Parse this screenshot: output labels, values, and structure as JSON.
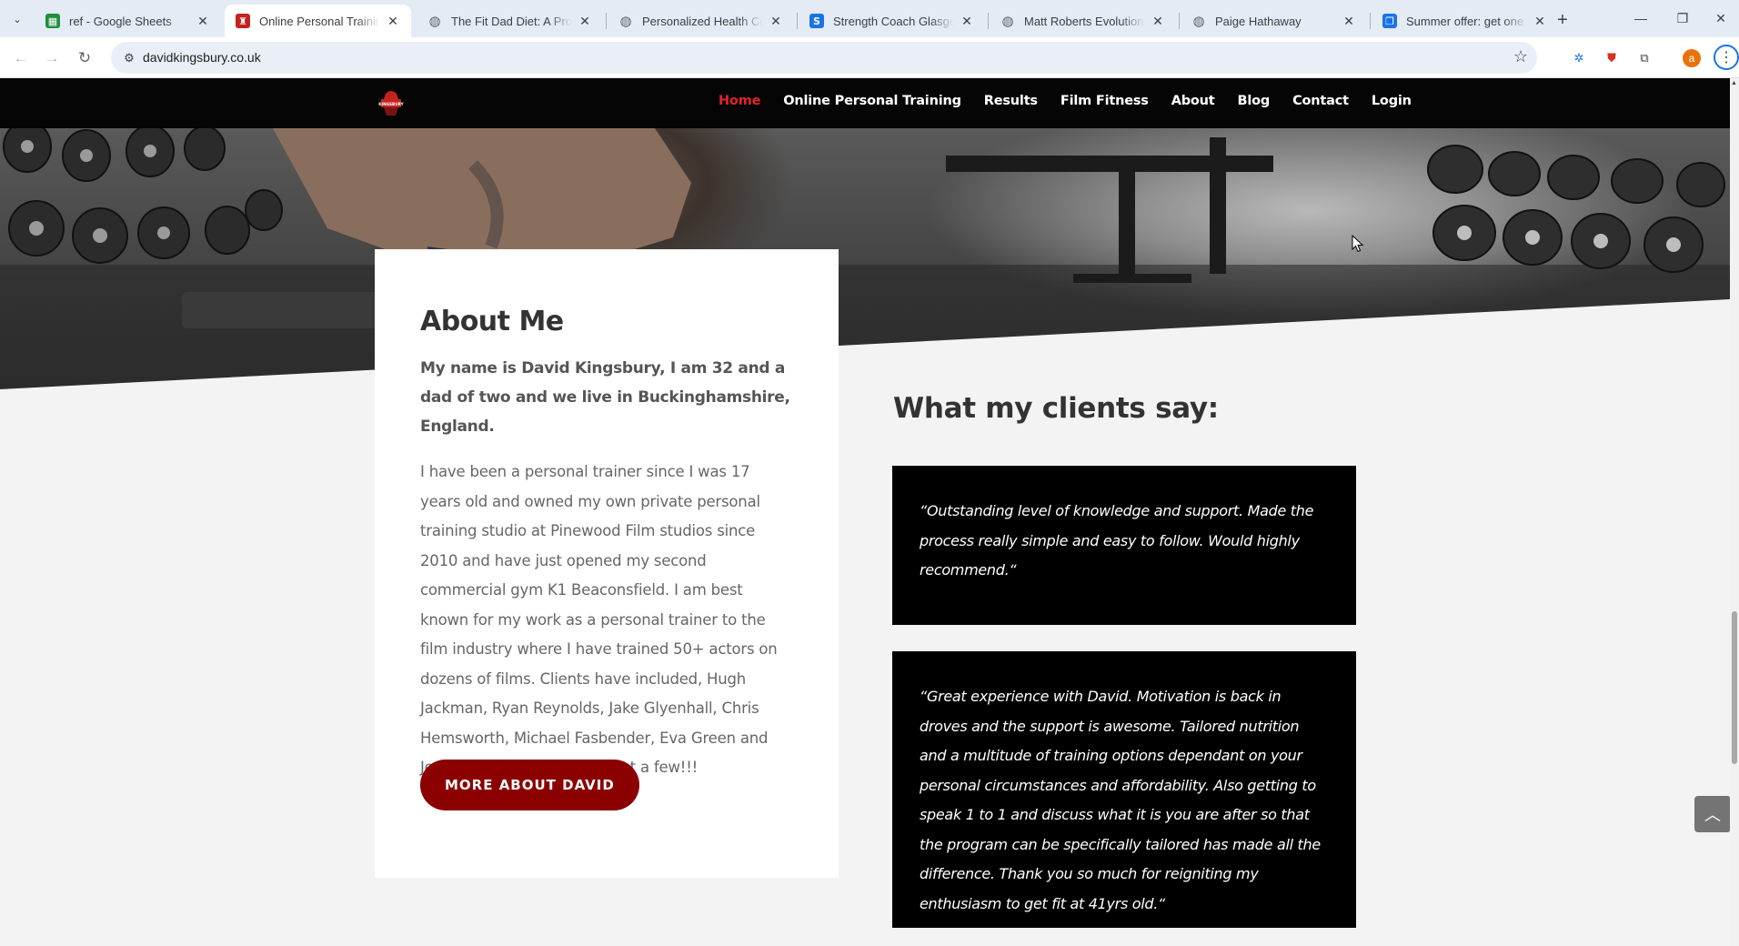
{
  "browser": {
    "tabs": [
      {
        "title": "ref - Google Sheets",
        "favicon": "sheets-icon",
        "color": "#1e8e3e",
        "active": false
      },
      {
        "title": "Online Personal Training &",
        "favicon": "dk-logo-icon",
        "color": "#c5221f",
        "active": true
      },
      {
        "title": "The Fit Dad Diet: A Proven",
        "favicon": "globe-icon",
        "color": "#5f6368",
        "active": false
      },
      {
        "title": "Personalized Health Coach",
        "favicon": "globe-icon",
        "color": "#5f6368",
        "active": false
      },
      {
        "title": "Strength Coach Glasgow",
        "favicon": "s-icon",
        "color": "#1a73e8",
        "active": false
      },
      {
        "title": "Matt Roberts Evolution | V",
        "favicon": "globe-icon",
        "color": "#5f6368",
        "active": false
      },
      {
        "title": "Paige Hathaway",
        "favicon": "globe-icon",
        "color": "#5f6368",
        "active": false
      },
      {
        "title": "Summer offer: get one mo",
        "favicon": "offer-icon",
        "color": "#1a73e8",
        "active": false
      }
    ],
    "url": "davidkingsbury.co.uk",
    "profile_initial": "a"
  },
  "site": {
    "logo_text": "KINGSBURY",
    "nav": [
      "Home",
      "Online Personal Training",
      "Results",
      "Film Fitness",
      "About",
      "Blog",
      "Contact",
      "Login"
    ],
    "nav_active_color": "#e0232b"
  },
  "about": {
    "title": "About Me",
    "lead": "My name is David Kingsbury, I am 32 and a dad of two and we live in Buckinghamshire, England.",
    "body": "I have been a personal trainer since I was 17 years old and owned my own private personal training studio at Pinewood Film studios since 2010 and have just opened my second commercial gym K1 Beaconsfield. I am best known for my work as a personal trainer to the film industry where I have trained 50+ actors on dozens of films. Clients have included, Hugh Jackman, Ryan Reynolds, Jake Glyenhall, Chris Hemsworth, Michael Fasbender, Eva Green and Jessica Chastain to name just a few!!!",
    "button": "MORE ABOUT DAVID",
    "button_color": "#8b0000"
  },
  "clients": {
    "title": "What my clients say:",
    "quotes": [
      "“Outstanding level of knowledge and support. Made the process really simple and easy to follow. Would highly recommend.“",
      "“Great experience with David. Motivation is back in droves and the support is awesome. Tailored nutrition and a multitude of training options dependant on your personal circumstances and affordability. Also getting to speak 1 to 1 and discuss what it is you are after so that the program can be specifically tailored has made all the difference. Thank you so much for reigniting my enthusiasm to get fit at 41yrs old.“"
    ]
  }
}
